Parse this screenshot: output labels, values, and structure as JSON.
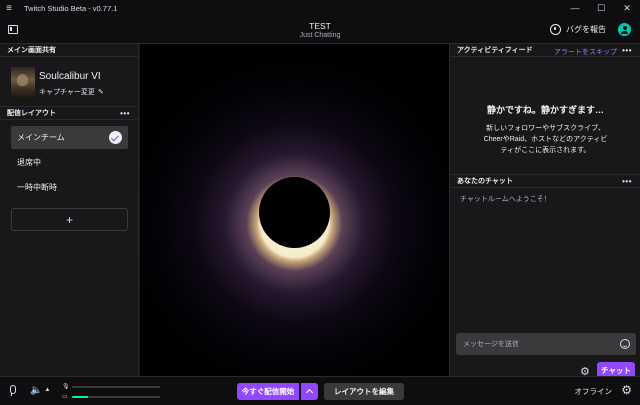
{
  "titlebar": {
    "app_title": "Twitch Studio Beta - v0.77.1",
    "menu_glyph": "≡",
    "minimize_glyph": "—",
    "maximize_glyph": "☐",
    "close_glyph": "✕"
  },
  "header": {
    "stream_title": "TEST",
    "category": "Just Chatting",
    "bug_report_label": "バグを報告"
  },
  "left_panel": {
    "main_share_header": "メイン画面共有",
    "source_name": "Soulcalibur VI",
    "change_capture_label": "キャプチャー変更",
    "pencil_glyph": "✎",
    "layout_header": "配信レイアウト",
    "more_glyph": "•••",
    "layouts": [
      {
        "label": "メインチーム"
      },
      {
        "label": "退席中"
      },
      {
        "label": "一時中断時"
      }
    ],
    "add_glyph": "+"
  },
  "right_panel": {
    "activity_header": "アクティビティフィード",
    "skip_alerts_label": "アラートをスキップ",
    "more_glyph": "•••",
    "quiet_title": "静かですね。静かすぎます…",
    "quiet_desc_line1": "新しいフォロワーやサブスクライブ、",
    "quiet_desc_line2": "CheerやRaid、ホストなどのアクティビ",
    "quiet_desc_line3": "ティがここに表示されます。",
    "chat_header": "あなたのチャット",
    "chat_welcome": "チャットルームへようこそ！",
    "chat_placeholder": "メッセージを送信",
    "gear_glyph": "⚙",
    "send_label": "チャット"
  },
  "bottom_bar": {
    "speaker_glyph": "🔈",
    "caret_glyph": "▲",
    "mic_meter_level": 0.0,
    "desktop_meter_level": 0.18,
    "go_live_label": "今すぐ配信開始",
    "edit_layout_label": "レイアウトを編集",
    "status_label": "オフライン",
    "settings_glyph": "⚙"
  },
  "colors": {
    "accent": "#9147ff",
    "background": "#18181b",
    "titlebar": "#0e0e10",
    "meter": "#00f593",
    "avatar": "#00c8af"
  }
}
